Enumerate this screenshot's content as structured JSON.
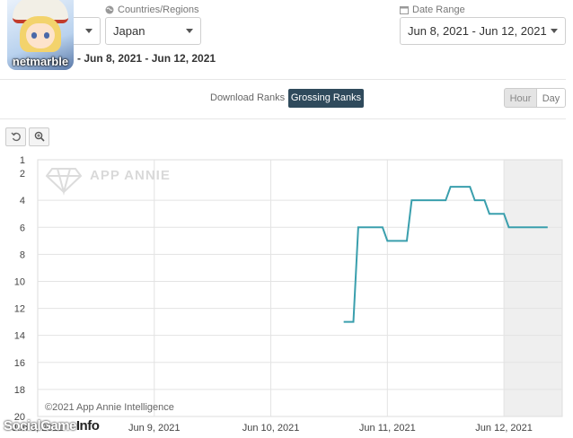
{
  "app": {
    "logo_text": "netmarble"
  },
  "filters": {
    "countries_label": "Countries/Regions",
    "country_value": "Japan",
    "date_range_label": "Date Range",
    "date_range_value": "Jun 8, 2021 - Jun 12, 2021",
    "subtitle": "- Jun 8, 2021 - Jun 12, 2021"
  },
  "rank_toggle": {
    "download_label": "Download Ranks",
    "grossing_label": "Grossing Ranks",
    "active": "Grossing Ranks"
  },
  "granularity": {
    "hour_label": "Hour",
    "day_label": "Day",
    "active": "Hour"
  },
  "tools": {
    "reset_icon": "undo-icon",
    "zoom_icon": "zoom-icon"
  },
  "watermark": "APP ANNIE",
  "copyright": "©2021 App Annie Intelligence",
  "credit": {
    "social": "Social",
    "game": "Game",
    "info": "Info"
  },
  "colors": {
    "line": "#3a9fad",
    "active_toggle": "#2f4a5c",
    "shaded_region": "#efefef"
  },
  "chart_data": {
    "type": "line",
    "title": "",
    "xlabel": "",
    "ylabel": "",
    "y_axis_inverted": true,
    "ylim": [
      1,
      20
    ],
    "y_ticks": [
      1,
      2,
      4,
      6,
      8,
      10,
      12,
      14,
      16,
      18,
      20
    ],
    "x_ticks": [
      "Jun 8, 2021",
      "Jun 9, 2021",
      "Jun 10, 2021",
      "Jun 11, 2021",
      "Jun 12, 2021"
    ],
    "grid": true,
    "shaded_region_start": "Jun 12, 2021 00:00",
    "series": [
      {
        "x": [
          "Jun 10, 2021 15:00",
          "Jun 10, 2021 17:00",
          "Jun 10, 2021 18:00",
          "Jun 10, 2021 23:00",
          "Jun 11, 2021 00:00",
          "Jun 11, 2021 04:00",
          "Jun 11, 2021 05:00",
          "Jun 11, 2021 12:00",
          "Jun 11, 2021 13:00",
          "Jun 11, 2021 17:00",
          "Jun 11, 2021 18:00",
          "Jun 11, 2021 20:00",
          "Jun 11, 2021 21:00",
          "Jun 11, 2021 23:00",
          "Jun 12, 2021 00:00",
          "Jun 12, 2021 01:00",
          "Jun 12, 2021 09:00"
        ],
        "y": [
          13,
          13,
          6,
          6,
          7,
          7,
          4,
          4,
          3,
          3,
          4,
          4,
          5,
          5,
          5,
          6,
          6
        ]
      }
    ]
  }
}
